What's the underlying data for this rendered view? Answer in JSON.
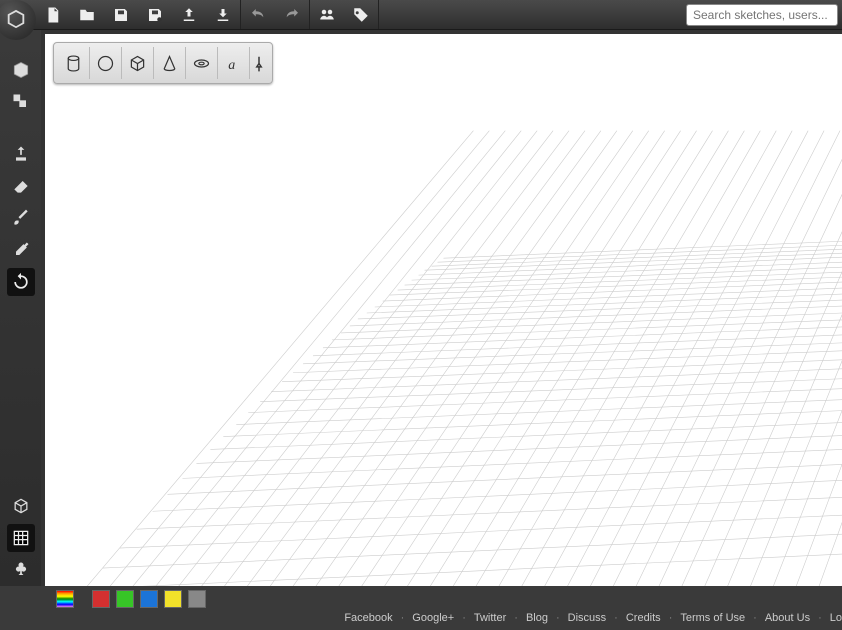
{
  "search": {
    "placeholder": "Search sketches, users..."
  },
  "swatches": {
    "rainbow": "linear-gradient(red, orange, yellow, green, blue, violet)",
    "red": "#d43030",
    "green": "#37c527",
    "blue": "#1c74d8",
    "yellow": "#f2e12a",
    "gray": "#888888"
  },
  "footer": {
    "facebook": "Facebook",
    "googleplus": "Google+",
    "twitter": "Twitter",
    "blog": "Blog",
    "discuss": "Discuss",
    "credits": "Credits",
    "terms": "Terms of Use",
    "about": "About Us",
    "login": "Lo"
  }
}
